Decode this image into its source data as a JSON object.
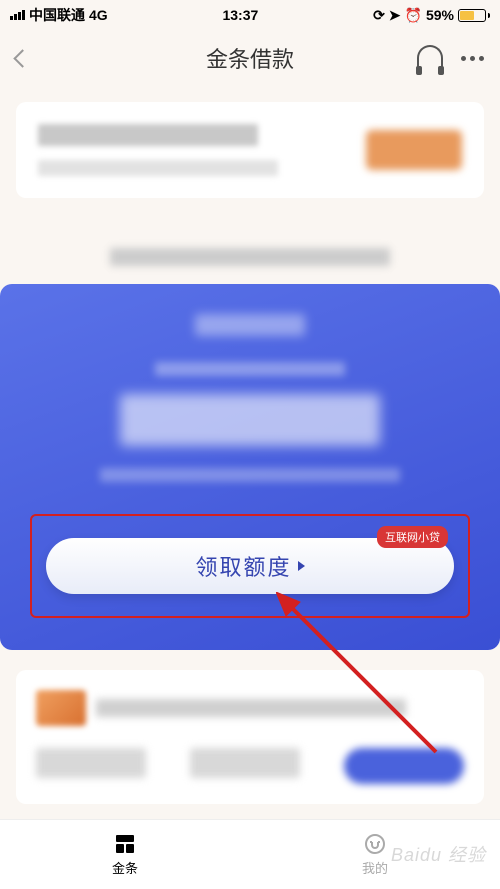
{
  "status": {
    "carrier": "中国联通",
    "network": "4G",
    "time": "13:37",
    "battery_pct": "59%"
  },
  "nav": {
    "title": "金条借款"
  },
  "hero": {
    "cta_label": "领取额度",
    "badge": "互联网小贷"
  },
  "tabs": {
    "jintiao": "金条",
    "mine": "我的"
  },
  "watermark": "Baidu 经验"
}
